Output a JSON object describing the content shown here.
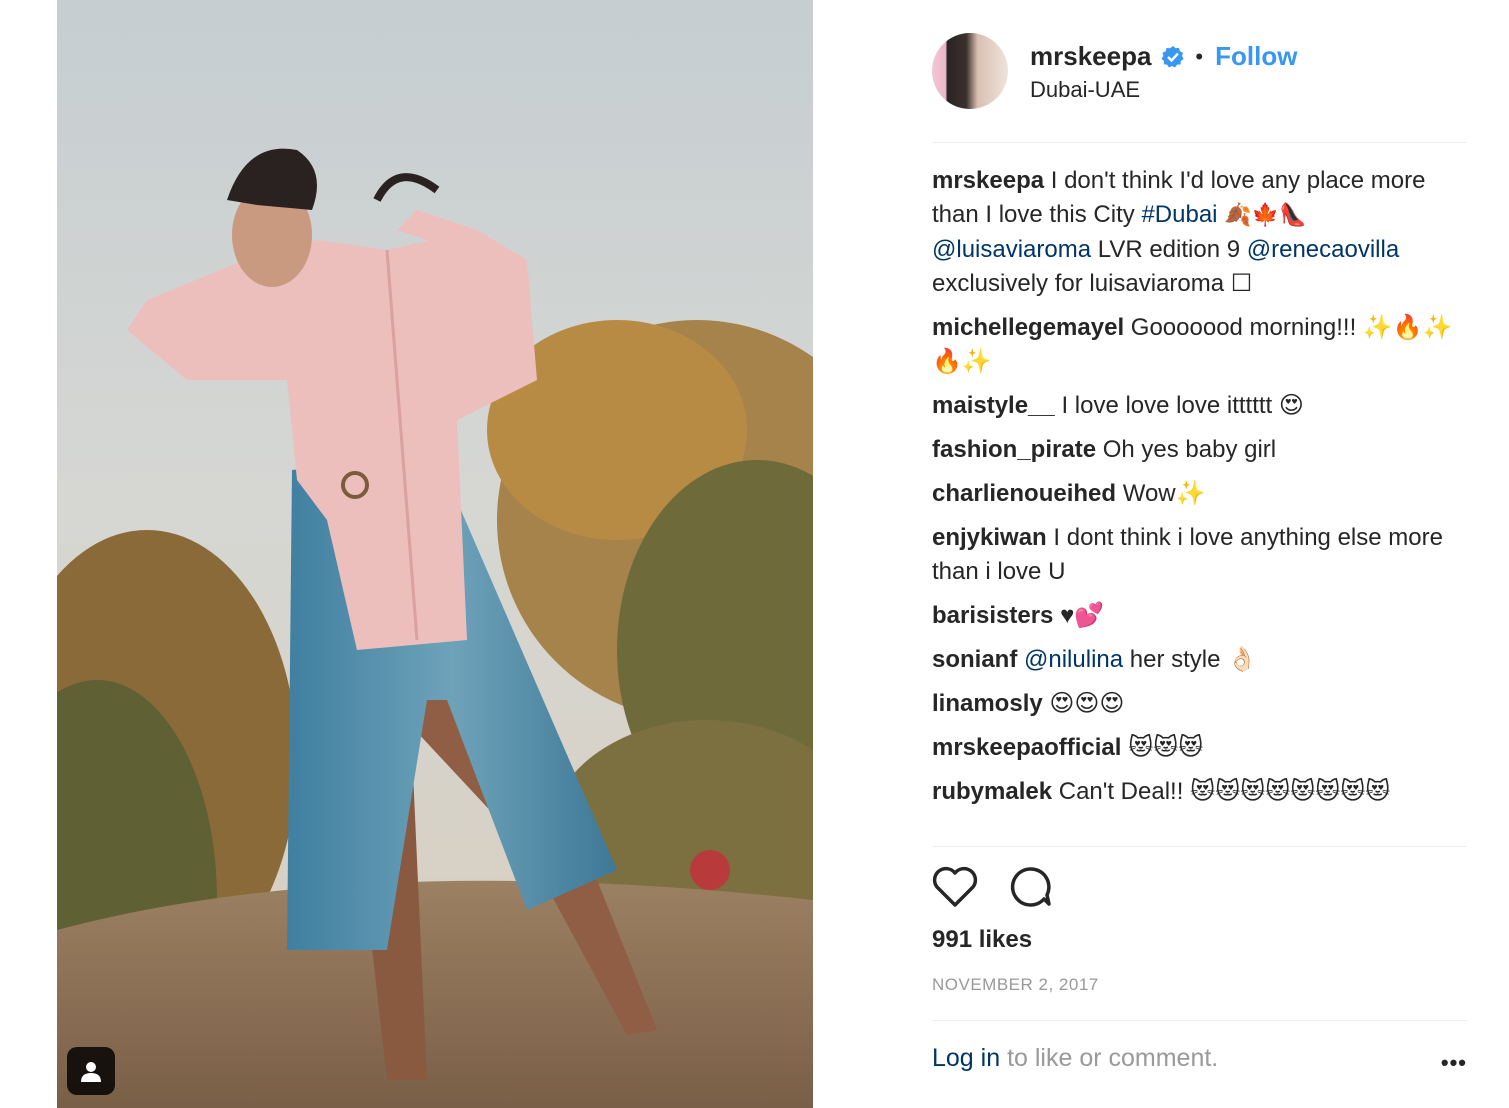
{
  "post": {
    "username": "mrskeepa",
    "follow_label": "Follow",
    "location": "Dubai-UAE",
    "likes": "991 likes",
    "date": "NOVEMBER 2, 2017",
    "separator": "•"
  },
  "caption": {
    "user": "mrskeepa",
    "part1": "I don't think I'd love any place more than I love this City ",
    "hashtag": "#Dubai",
    "emojis1": "🍂🍁👠",
    "mention1": "@luisaviaroma",
    "part2": " LVR edition 9 ",
    "mention2": "@renecaovilla",
    "part3": " exclusively for luisaviaroma ☐"
  },
  "comments": [
    {
      "user": "michellegemayel",
      "text": "Gooooood morning!!! ✨🔥✨🔥✨"
    },
    {
      "user": "maistyle__",
      "text": "I love love love itttttt 😍"
    },
    {
      "user": "fashion_pirate",
      "text": "Oh yes baby girl"
    },
    {
      "user": "charlienoueihed",
      "text": "Wow✨"
    },
    {
      "user": "enjykiwan",
      "text": "I dont think i love anything else more than i love U"
    },
    {
      "user": "barisisters",
      "text": "♥💕"
    },
    {
      "user": "sonianf",
      "mention": "@nilulina",
      "text": " her style 👌🏻"
    },
    {
      "user": "linamosly",
      "text": "😍😍😍"
    },
    {
      "user": "mrskeepaofficial",
      "text": "😻😻😻"
    },
    {
      "user": "rubymalek",
      "text": "Can't Deal!! 😻😻😻😻😻😻😻😻"
    }
  ],
  "footer": {
    "login": "Log in",
    "rest": " to like or comment.",
    "more": "•••"
  },
  "icons": {
    "verified": "verified-badge-icon",
    "like": "heart-icon",
    "comment": "comment-bubble-icon",
    "user_tag": "user-tag-icon",
    "more": "more-options-icon"
  },
  "colors": {
    "link": "#003569",
    "follow": "#3897f0",
    "muted": "#999999"
  }
}
